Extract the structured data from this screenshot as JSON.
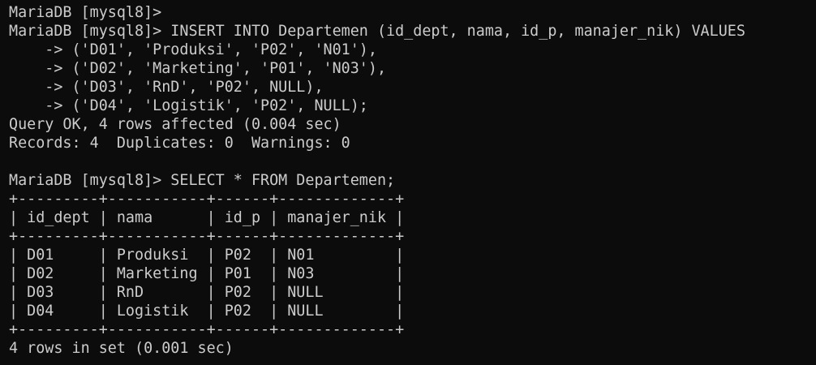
{
  "terminal": {
    "lines": [
      "MariaDB [mysql8]>",
      "MariaDB [mysql8]> INSERT INTO Departemen (id_dept, nama, id_p, manajer_nik) VALUES",
      "    -> ('D01', 'Produksi', 'P02', 'N01'),",
      "    -> ('D02', 'Marketing', 'P01', 'N03'),",
      "    -> ('D03', 'RnD', 'P02', NULL),",
      "    -> ('D04', 'Logistik', 'P02', NULL);",
      "Query OK, 4 rows affected (0.004 sec)",
      "Records: 4  Duplicates: 0  Warnings: 0",
      "",
      "MariaDB [mysql8]> SELECT * FROM Departemen;",
      "+---------+-----------+------+-------------+",
      "| id_dept | nama      | id_p | manajer_nik |",
      "+---------+-----------+------+-------------+",
      "| D01     | Produksi  | P02  | N01         |",
      "| D02     | Marketing | P01  | N03         |",
      "| D03     | RnD       | P02  | NULL        |",
      "| D04     | Logistik  | P02  | NULL        |",
      "+---------+-----------+------+-------------+",
      "4 rows in set (0.001 sec)"
    ]
  }
}
